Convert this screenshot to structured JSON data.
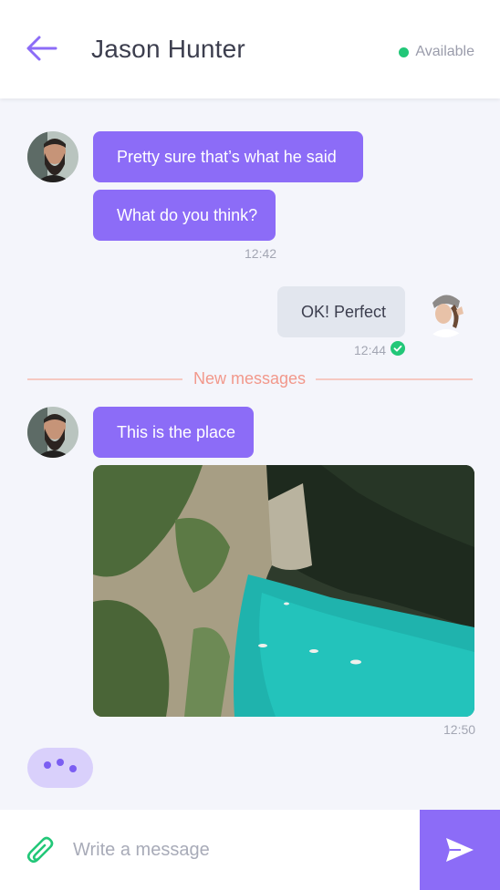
{
  "header": {
    "back_icon": "arrow-left-icon",
    "contact_name": "Jason Hunter",
    "status_text": "Available",
    "status_color": "#22c778"
  },
  "messages": [
    {
      "from": "contact",
      "text": "Pretty sure that’s what he said"
    },
    {
      "from": "contact",
      "text": "What do you think?",
      "time": "12:42"
    },
    {
      "from": "me",
      "text": "OK! Perfect",
      "time": "12:44",
      "read_icon": "check-circle-icon"
    },
    {
      "from": "contact",
      "text": "This is the place"
    },
    {
      "from": "contact",
      "image": "river-canyon-photo",
      "time": "12:50"
    }
  ],
  "divider": {
    "label": "New messages"
  },
  "typing_indicator": {
    "icon": "typing-dots-icon"
  },
  "composer": {
    "attach_icon": "paperclip-icon",
    "placeholder": "Write a message",
    "value": "",
    "send_icon": "send-icon"
  },
  "colors": {
    "accent": "#8c6cf7",
    "outgoing_bubble": "#e2e6ee",
    "divider": "#f2988b",
    "read_check": "#22c778"
  }
}
